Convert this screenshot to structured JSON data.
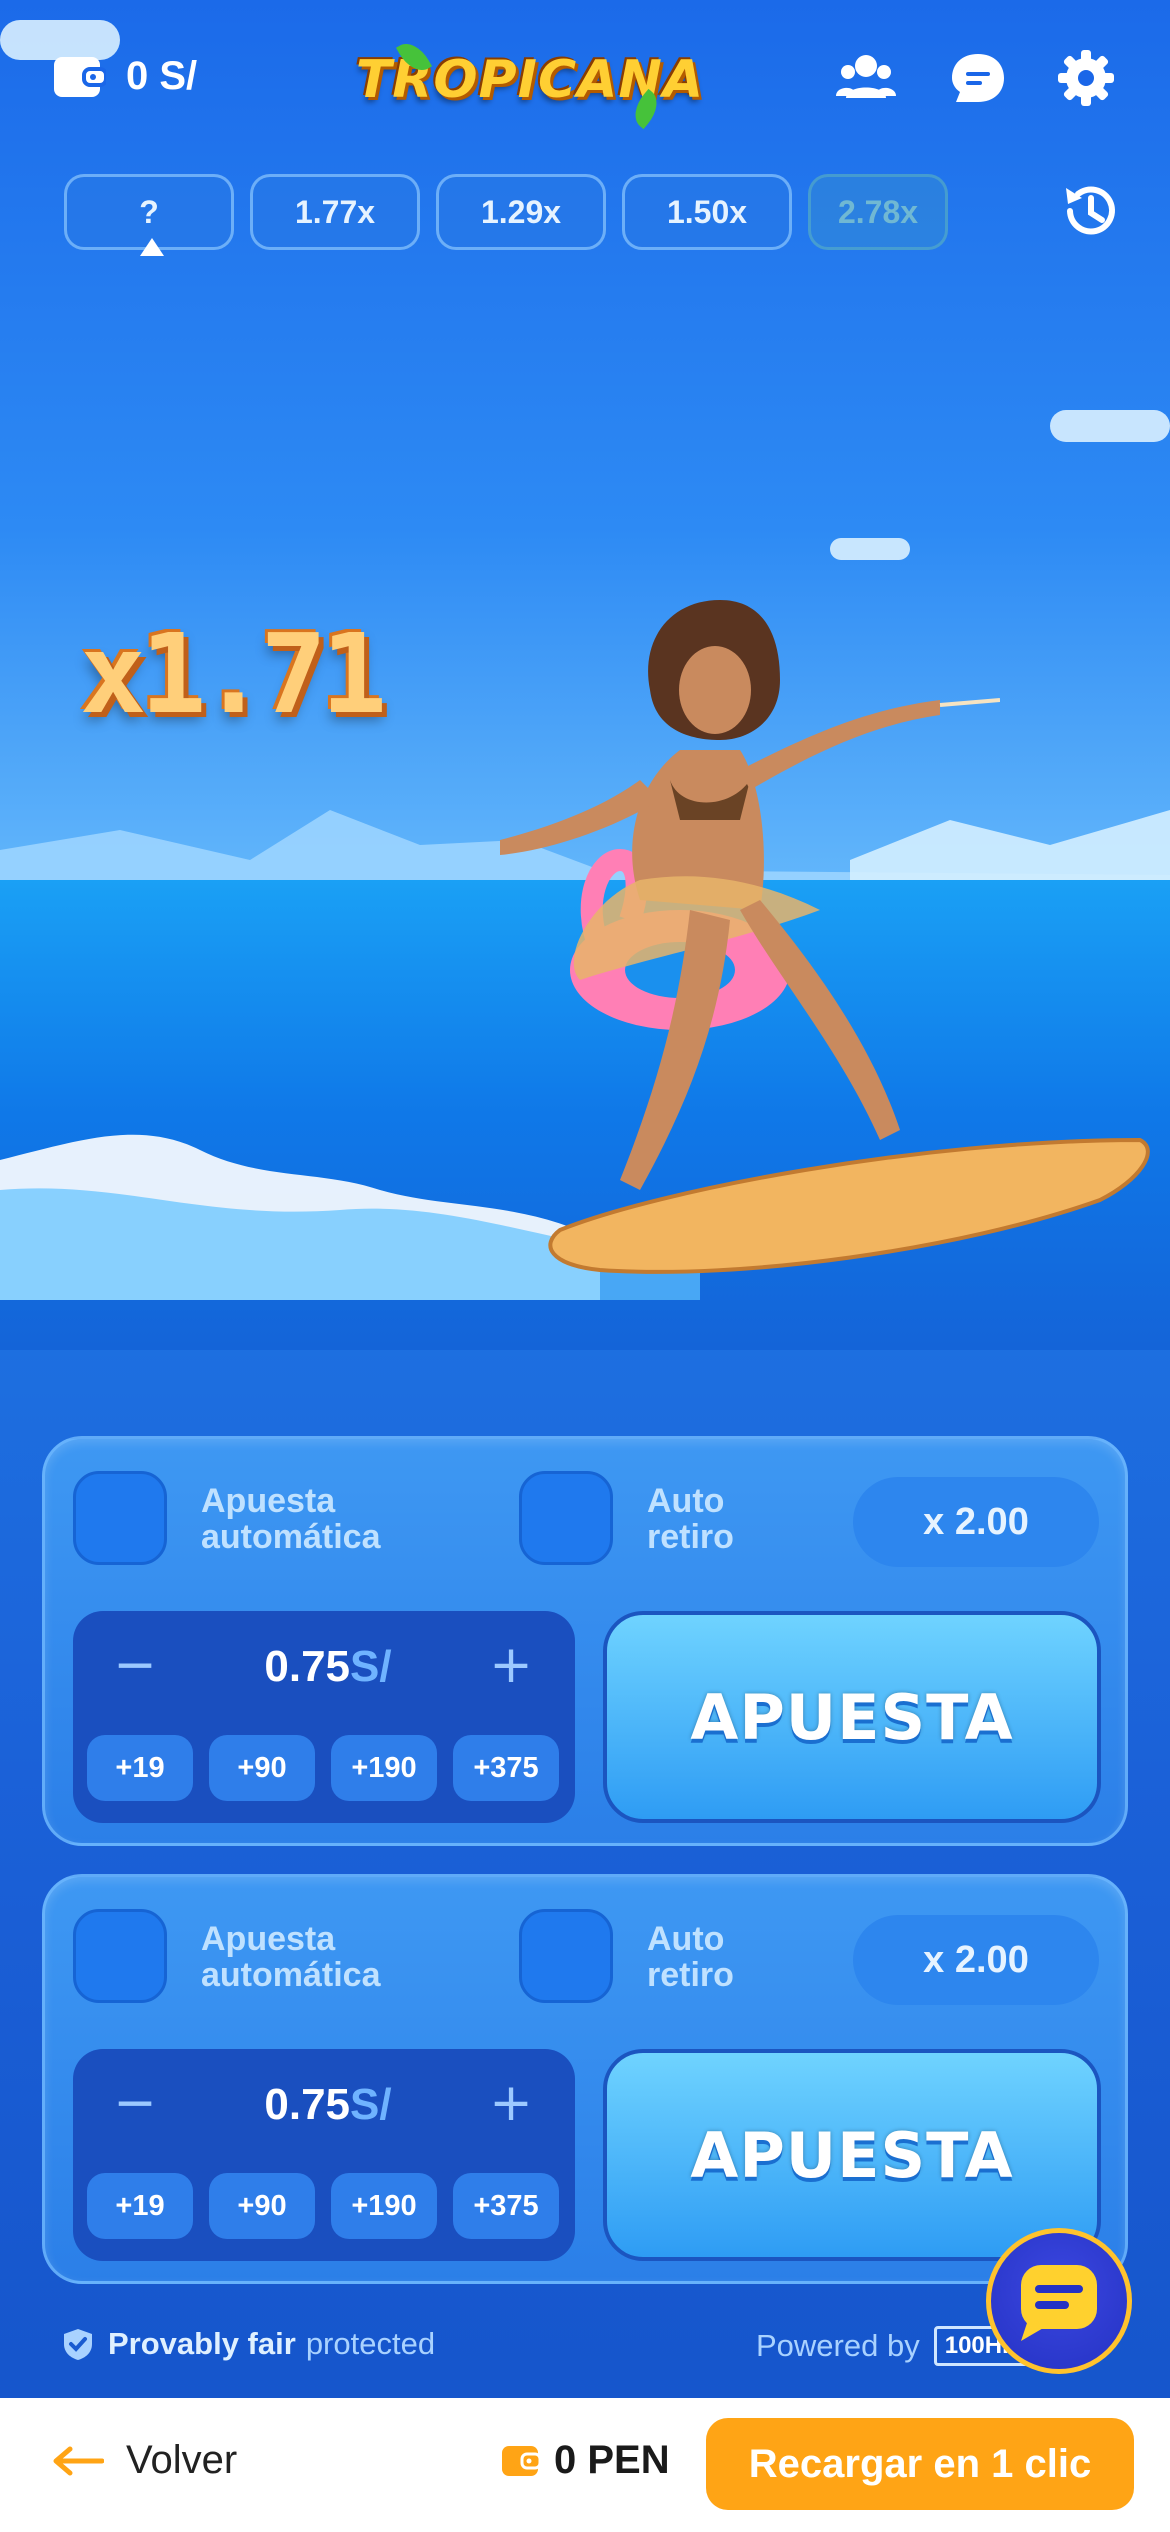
{
  "header": {
    "balance": "0 S/",
    "logo_text": "TROPICANA",
    "icons": [
      "wallet-icon",
      "users-icon",
      "chat-icon",
      "settings-icon"
    ]
  },
  "history": {
    "items": [
      "?",
      "1.77x",
      "1.29x",
      "1.50x",
      "2.78x"
    ],
    "icon": "history-icon"
  },
  "game": {
    "multiplier": "x1.71"
  },
  "panels": [
    {
      "auto_bet_label": "Apuesta\nautomática",
      "auto_cashout_label": "Auto\nretiro",
      "cashout_multiplier": "x 2.00",
      "amount_value": "0.75",
      "amount_currency": "S/",
      "minus": "−",
      "plus": "+",
      "chips": [
        "+19",
        "+90",
        "+190",
        "+375"
      ],
      "bet_button": "APUESTA"
    },
    {
      "auto_bet_label": "Apuesta\nautomática",
      "auto_cashout_label": "Auto\nretiro",
      "cashout_multiplier": "x 2.00",
      "amount_value": "0.75",
      "amount_currency": "S/",
      "minus": "−",
      "plus": "+",
      "chips": [
        "+19",
        "+90",
        "+190",
        "+375"
      ],
      "bet_button": "APUESTA"
    }
  ],
  "footer": {
    "fair_strong": "Provably fair",
    "fair_light": "protected",
    "powered_by": "Powered by",
    "provider": "100HP"
  },
  "bottom_bar": {
    "back_label": "Volver",
    "balance": "0 PEN",
    "recharge_label": "Recargar en 1 clic"
  },
  "colors": {
    "accent_orange": "#ffa415",
    "panel_blue": "#2b7fe8",
    "bet_button": "#2e9cf4",
    "multiplier": "#ffcf7a"
  }
}
